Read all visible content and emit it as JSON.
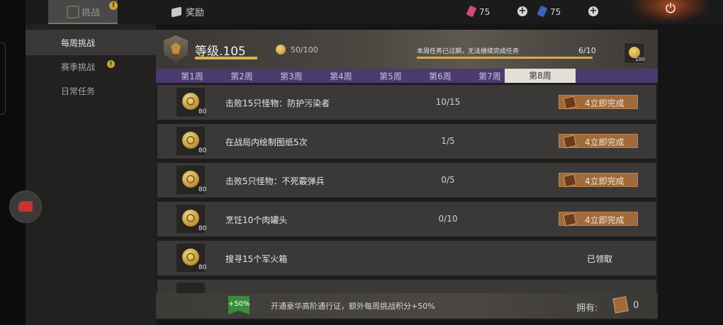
{
  "topbar": {
    "tab_challenge": "挑战",
    "tab_reward": "奖励",
    "currency_red": "75",
    "currency_blue": "75",
    "plus": "+",
    "power_icon": "⏻"
  },
  "sidebar": {
    "items": [
      {
        "label": "每周挑战"
      },
      {
        "label": "赛季挑战"
      },
      {
        "label": "日常任务"
      }
    ]
  },
  "header": {
    "level": "等级.105",
    "points": "50/100",
    "expired_notice": "本周任务已过期，无法继续完成任务",
    "tasks_progress": "6/10",
    "reward_count": "100"
  },
  "weeks": [
    "第1周",
    "第2周",
    "第3周",
    "第4周",
    "第5周",
    "第6周",
    "第7周",
    "第8周"
  ],
  "tasks": [
    {
      "reward": "80",
      "name": "击败15只怪物：防护污染者",
      "progress": "10/15",
      "action": "4立即完成"
    },
    {
      "reward": "80",
      "name": "在战局内绘制图纸5次",
      "progress": "1/5",
      "action": "4立即完成"
    },
    {
      "reward": "80",
      "name": "击败5只怪物：不死霰弹兵",
      "progress": "0/5",
      "action": "4立即完成"
    },
    {
      "reward": "80",
      "name": "烹饪10个肉罐头",
      "progress": "0/10",
      "action": "4立即完成"
    },
    {
      "reward": "80",
      "name": "搜寻15个军火箱",
      "status": "已领取"
    }
  ],
  "bottom": {
    "bonus": "+50%",
    "text": "开通豪华高阶通行证，额外每周挑战积分+50%",
    "owned_label": "拥有:",
    "owned_count": "0"
  },
  "colors": {
    "accent_gold": "#d9b24a",
    "week_purple": "#4b3a6e",
    "finish_button": "#a16a3a",
    "bonus_green": "#3d8a3a"
  },
  "icons": [
    "challenge-icon",
    "reward-icon",
    "red-gem-icon",
    "blue-card-icon",
    "power-icon",
    "coin-icon",
    "medal-icon",
    "ticket-icon",
    "notice-badge-icon"
  ]
}
